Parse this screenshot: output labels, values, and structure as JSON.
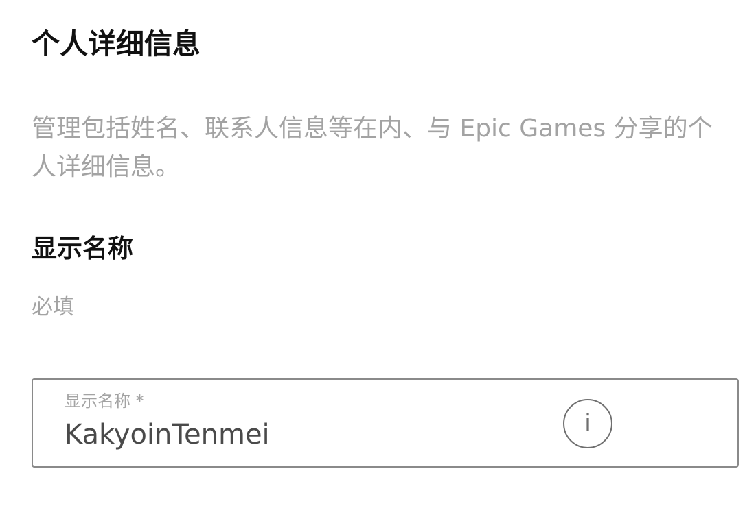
{
  "personal_details": {
    "title": "个人详细信息",
    "description": "管理包括姓名、联系人信息等在内、与 Epic Games 分享的个人详细信息。"
  },
  "display_name": {
    "title": "显示名称",
    "required_text": "必填",
    "input_label": "显示名称 *",
    "input_value": "KakyoinTenmei",
    "info_icon": "info-icon",
    "info_glyph": "i"
  },
  "colors": {
    "heading": "#111111",
    "muted_text": "#a3a3a3",
    "input_border": "#8a8a8a",
    "input_text": "#4a4a4a",
    "icon": "#6f6f6f"
  }
}
